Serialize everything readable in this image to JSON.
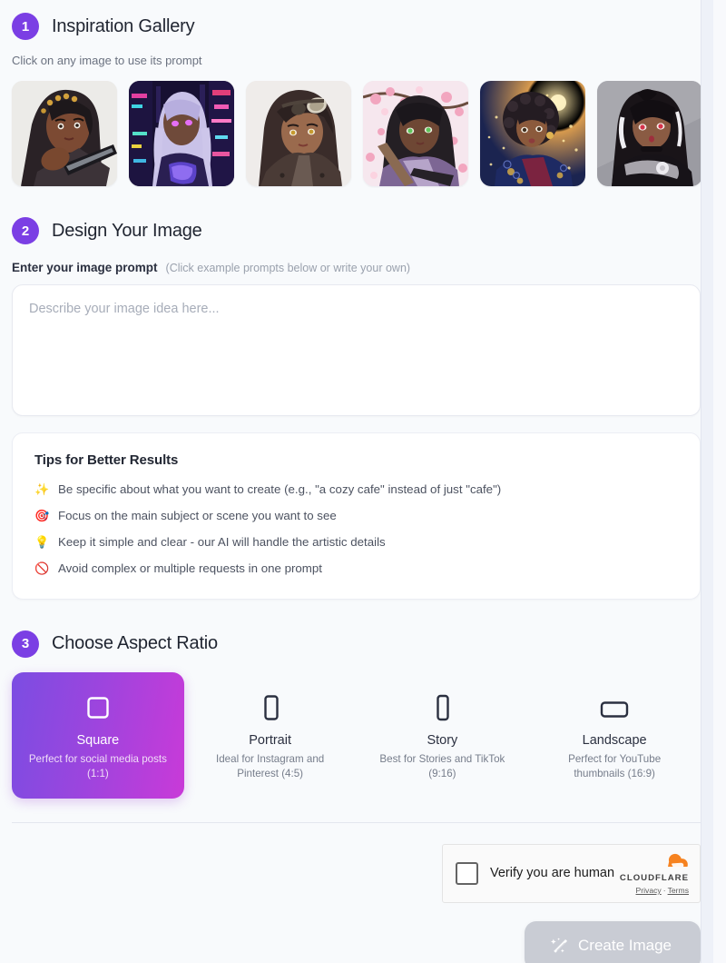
{
  "sections": {
    "gallery": {
      "step": "1",
      "title": "Inspiration Gallery",
      "subtitle": "Click on any image to use its prompt",
      "images": [
        {
          "alt": "anime warrior woman with dreadlocks and gold beads holding a blade"
        },
        {
          "alt": "cyberpunk anime woman with silver braids in neon city"
        },
        {
          "alt": "anime woman with aviator goggles and brown leather jacket"
        },
        {
          "alt": "anime samurai woman under cherry blossoms with green eyes"
        },
        {
          "alt": "anime woman with afro in kimono under golden light"
        },
        {
          "alt": "anime gothic lolita woman with red eyes and black lace"
        }
      ]
    },
    "design": {
      "step": "2",
      "title": "Design Your Image",
      "prompt_label": "Enter your image prompt",
      "prompt_hint": "(Click example prompts below or write your own)",
      "prompt_value": "",
      "prompt_placeholder": "Describe your image idea here..."
    },
    "tips": {
      "title": "Tips for Better Results",
      "items": [
        {
          "icon": "sparkles-icon",
          "emoji": "✨",
          "text": "Be specific about what you want to create (e.g., \"a cozy cafe\" instead of just \"cafe\")"
        },
        {
          "icon": "dart-icon",
          "emoji": "🎯",
          "text": "Focus on the main subject or scene you want to see"
        },
        {
          "icon": "lightbulb-icon",
          "emoji": "💡",
          "text": "Keep it simple and clear - our AI will handle the artistic details"
        },
        {
          "icon": "prohibited-icon",
          "emoji": "🚫",
          "text": "Avoid complex or multiple requests in one prompt"
        }
      ]
    },
    "aspect_ratio": {
      "step": "3",
      "title": "Choose Aspect Ratio",
      "selected": "Square",
      "options": [
        {
          "name": "Square",
          "desc": "Perfect for social media posts (1:1)",
          "icon": "square-frame-icon",
          "ratio": "1:1",
          "selected": true
        },
        {
          "name": "Portrait",
          "desc": "Ideal for Instagram and Pinterest (4:5)",
          "icon": "portrait-frame-icon",
          "ratio": "4:5",
          "selected": false
        },
        {
          "name": "Story",
          "desc": "Best for Stories and TikTok (9:16)",
          "icon": "story-frame-icon",
          "ratio": "9:16",
          "selected": false
        },
        {
          "name": "Landscape",
          "desc": "Perfect for YouTube thumbnails (16:9)",
          "icon": "landscape-frame-icon",
          "ratio": "16:9",
          "selected": false
        }
      ]
    },
    "turnstile": {
      "label": "Verify you are human",
      "checked": false,
      "brand": "CLOUDFLARE",
      "privacy": "Privacy",
      "separator": "·",
      "terms": "Terms"
    },
    "submit": {
      "label": "Create Image",
      "icon": "magic-wand-icon",
      "disabled": true
    }
  },
  "colors": {
    "accent_purple": "#7b3fe4",
    "gradient_from": "#7b4de2",
    "gradient_to": "#c93ad8",
    "page_bg": "#f8fafc",
    "card_bg": "#ffffff",
    "text_primary": "#2b3040",
    "text_muted": "#6b7280",
    "disabled_button": "#c9ccd4",
    "cloudflare_orange": "#f6821f"
  }
}
